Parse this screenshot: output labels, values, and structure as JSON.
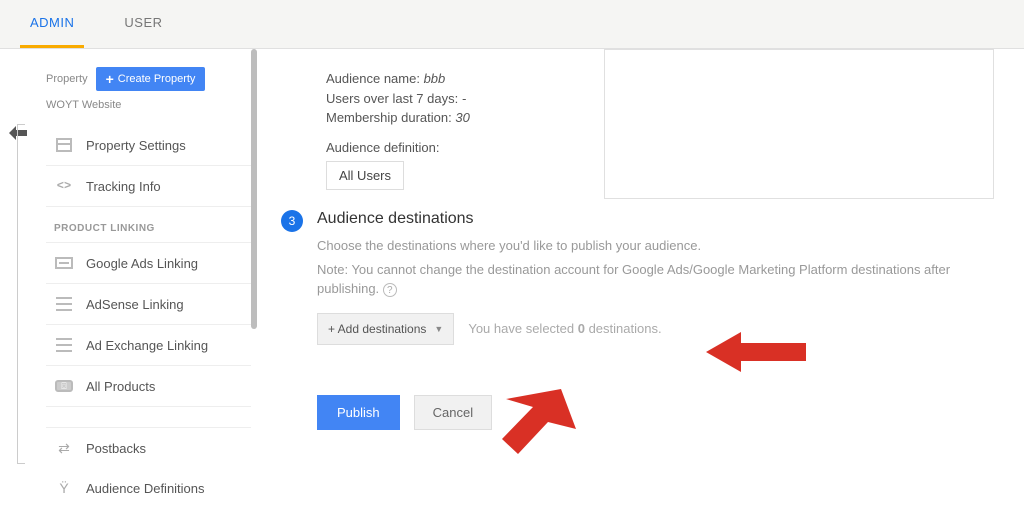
{
  "tabs": {
    "admin": "ADMIN",
    "user": "USER"
  },
  "sidebar": {
    "property_label": "Property",
    "create_property": "Create Property",
    "property_name": "WOYT Website",
    "items": {
      "property_settings": "Property Settings",
      "tracking_info": "Tracking Info",
      "product_linking_header": "PRODUCT LINKING",
      "google_ads": "Google Ads Linking",
      "adsense": "AdSense Linking",
      "ad_exchange": "Ad Exchange Linking",
      "all_products": "All Products",
      "postbacks": "Postbacks",
      "audience_defs": "Audience Definitions"
    }
  },
  "audience": {
    "name_label": "Audience name:",
    "name_value": "bbb",
    "users_label": "Users over last 7 days:",
    "users_value": "-",
    "duration_label": "Membership duration:",
    "duration_value": "30",
    "def_label": "Audience definition:",
    "def_value": "All Users"
  },
  "step": {
    "number": "3",
    "title": "Audience destinations",
    "desc1": "Choose the destinations where you'd like to publish your audience.",
    "desc2": "Note: You cannot change the destination account for Google Ads/Google Marketing Platform destinations after publishing.",
    "add_btn": "+ Add destinations",
    "status_pre": "You have selected ",
    "status_bold": "0",
    "status_post": " destinations."
  },
  "actions": {
    "publish": "Publish",
    "cancel": "Cancel"
  }
}
